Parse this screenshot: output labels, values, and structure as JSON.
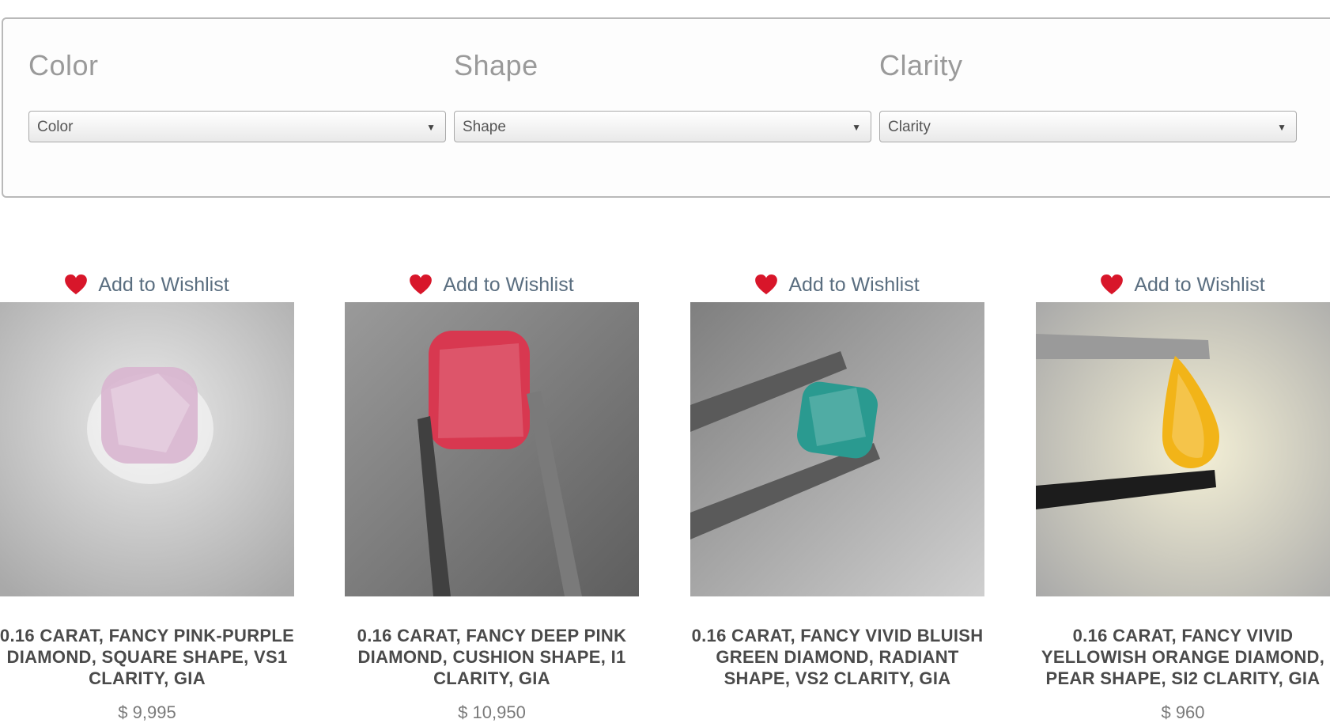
{
  "filters": [
    {
      "label": "Color",
      "selected": "Color"
    },
    {
      "label": "Shape",
      "selected": "Shape"
    },
    {
      "label": "Clarity",
      "selected": "Clarity"
    }
  ],
  "wishlist_label": "Add to Wishlist",
  "products": [
    {
      "title": "0.16 CARAT, FANCY PINK-PURPLE DIAMOND, SQUARE SHAPE, VS1 CLARITY, GIA",
      "price": "$ 9,995",
      "gem_color": "#d8b5cf"
    },
    {
      "title": "0.16 CARAT, FANCY DEEP PINK DIAMOND, CUSHION SHAPE, I1 CLARITY, GIA",
      "price": "$ 10,950",
      "gem_color": "#d83850"
    },
    {
      "title": "0.16 CARAT, FANCY VIVID BLUISH GREEN DIAMOND, RADIANT SHAPE, VS2 CLARITY, GIA",
      "price": "",
      "gem_color": "#2a9a90"
    },
    {
      "title": "0.16 CARAT, FANCY VIVID YELLOWISH ORANGE DIAMOND, PEAR SHAPE, SI2 CLARITY, GIA",
      "price": "$ 960",
      "gem_color": "#f2b418"
    }
  ],
  "colors": {
    "heart": "#d8162a",
    "wishlist_text": "#5a6e80",
    "title_text": "#4a4a4a"
  }
}
